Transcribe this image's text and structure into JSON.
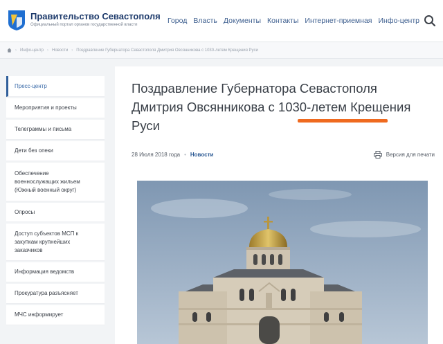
{
  "header": {
    "site_title": "Правительство Севастополя",
    "site_subtitle": "Официальный портал органов государственной власти",
    "nav": [
      "Город",
      "Власть",
      "Документы",
      "Контакты",
      "Интернет-приемная",
      "Инфо-центр"
    ],
    "search_icon": "search-icon"
  },
  "breadcrumb": [
    "Инфо-центр",
    "Новости",
    "Поздравление Губернатора Севастополя Дмитрия Овсянникова с 1030-летем Крещения Руси"
  ],
  "sidebar": {
    "items": [
      "Пресс-центр",
      "Мероприятия и проекты",
      "Телеграммы и письма",
      "Дети без опеки",
      "Обеспечение военнослужащих жильем (Южный военный округ)",
      "Опросы",
      "Доступ субъектов МСП к закупкам крупнейших заказчиков",
      "Информация ведомств",
      "Прокуратура разъясняет",
      "МЧС информирует"
    ],
    "active_index": 0
  },
  "article": {
    "title": "Поздравление Губернатора Севастополя Дмитрия Овсянникова с 1030-летем Крещения Руси",
    "date": "28 Июля 2018 года",
    "category": "Новости",
    "print_label": "Версия для печати"
  },
  "colors": {
    "accent": "#2f5e9a",
    "highlight": "#ef6a1f",
    "nav_link": "#3e5f8f"
  }
}
